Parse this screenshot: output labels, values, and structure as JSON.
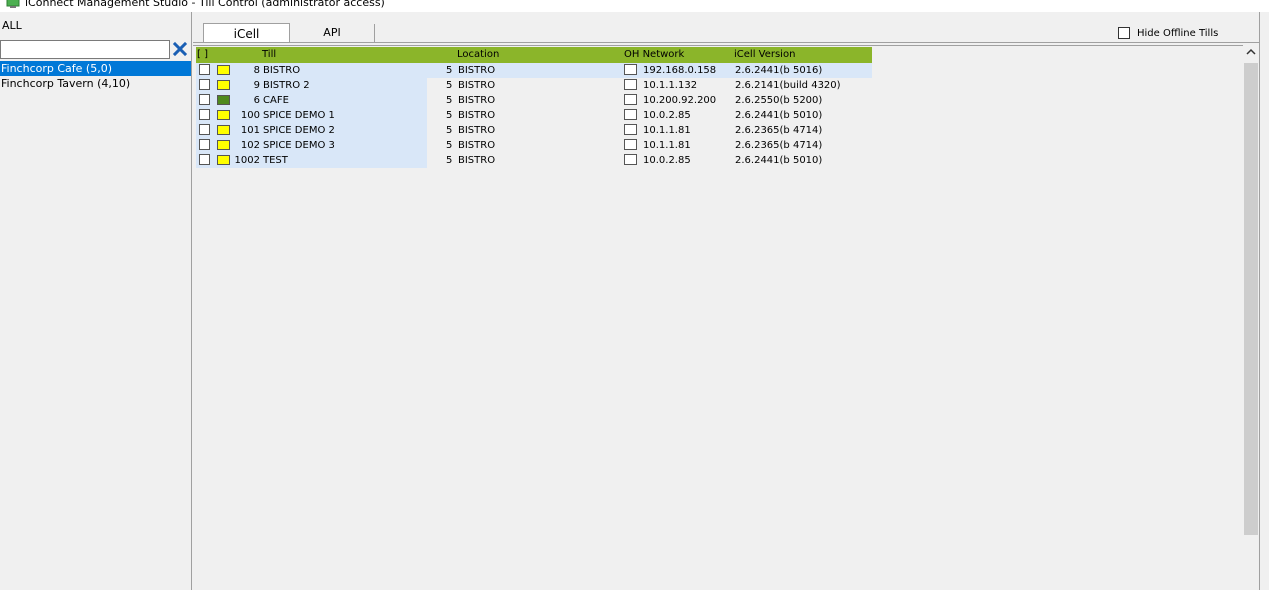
{
  "window": {
    "title": "iConnect Management Studio - Till Control (administrator access)"
  },
  "left_pane": {
    "all_label": "ALL",
    "filter": {
      "value": "",
      "placeholder": ""
    },
    "sites": [
      {
        "label": "Finchcorp Cafe  (5,0)",
        "selected": true
      },
      {
        "label": "Finchcorp Tavern (4,10)",
        "selected": false
      }
    ]
  },
  "tabs": [
    {
      "label": "iCell",
      "active": true
    },
    {
      "label": "API",
      "active": false
    }
  ],
  "hide_offline": {
    "label": "Hide Offline Tills",
    "checked": false
  },
  "grid": {
    "headers": {
      "select": "[ ]",
      "till": "Till",
      "location": "Location",
      "oh_network": "OH Network",
      "icell_version": "iCell Version"
    },
    "rows": [
      {
        "num": "8",
        "till": "BISTRO",
        "loc_num": "5",
        "location": "BISTRO",
        "ip": "192.168.0.158",
        "version": "2.6.2441(b 5016)",
        "status_color": "#ffff00"
      },
      {
        "num": "9",
        "till": "BISTRO 2",
        "loc_num": "5",
        "location": "BISTRO",
        "ip": "10.1.1.132",
        "version": "2.6.2141(build 4320)",
        "status_color": "#ffff00"
      },
      {
        "num": "6",
        "till": "CAFE",
        "loc_num": "5",
        "location": "BISTRO",
        "ip": "10.200.92.200",
        "version": "2.6.2550(b 5200)",
        "status_color": "#4f8a1e"
      },
      {
        "num": "100",
        "till": "SPICE DEMO 1",
        "loc_num": "5",
        "location": "BISTRO",
        "ip": "10.0.2.85",
        "version": "2.6.2441(b 5010)",
        "status_color": "#ffff00"
      },
      {
        "num": "101",
        "till": "SPICE DEMO 2",
        "loc_num": "5",
        "location": "BISTRO",
        "ip": "10.1.1.81",
        "version": "2.6.2365(b 4714)",
        "status_color": "#ffff00"
      },
      {
        "num": "102",
        "till": "SPICE DEMO 3",
        "loc_num": "5",
        "location": "BISTRO",
        "ip": "10.1.1.81",
        "version": "2.6.2365(b 4714)",
        "status_color": "#ffff00"
      },
      {
        "num": "1002",
        "till": "TEST",
        "loc_num": "5",
        "location": "BISTRO",
        "ip": "10.0.2.85",
        "version": "2.6.2441(b 5010)",
        "status_color": "#ffff00"
      }
    ]
  },
  "colors": {
    "header_green": "#8bb52a",
    "selection_blue": "#0078d7",
    "row_band": "#d9e7f8"
  }
}
